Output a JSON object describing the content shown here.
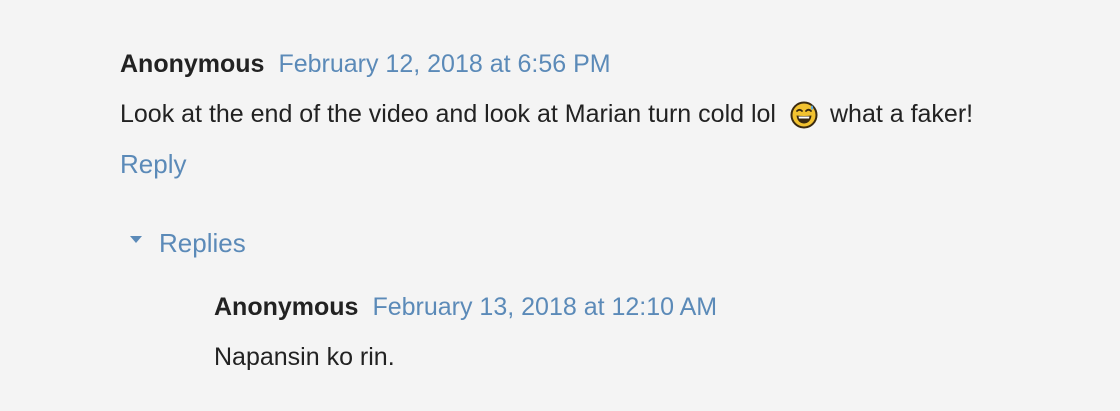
{
  "comments": [
    {
      "author": "Anonymous",
      "timestamp": "February 12, 2018 at 6:56 PM",
      "text_before_emoji": "Look at the end of the video and look at Marian turn cold lol",
      "emoji": "grinning-sweat-emoji",
      "text_after_emoji": "what a faker!",
      "reply_label": "Reply"
    }
  ],
  "replies_section": {
    "toggle_icon": "caret-down-icon",
    "label": "Replies",
    "items": [
      {
        "author": "Anonymous",
        "timestamp": "February 13, 2018 at 12:10 AM",
        "text": "Napansin ko rin."
      }
    ]
  },
  "colors": {
    "background": "#f4f4f4",
    "text": "#222222",
    "link": "#5b8ab8"
  }
}
